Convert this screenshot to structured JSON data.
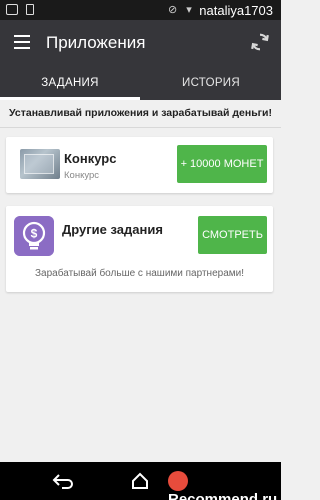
{
  "status_bar": {
    "time": "nataliya1703",
    "sys_icons": "⊘ ▾"
  },
  "app_bar": {
    "title": "Приложения"
  },
  "tabs": [
    {
      "label": "ЗАДАНИЯ",
      "active": true
    },
    {
      "label": "ИСТОРИЯ",
      "active": false
    }
  ],
  "banner": "Устанавливай приложения и зарабатывай деньги!",
  "cards": [
    {
      "title": "Конкурс",
      "subtitle": "Конкурс",
      "button": "+ 10000 МОНЕТ"
    },
    {
      "title": "Другие задания",
      "button": "СМОТРЕТЬ",
      "footer": "Зарабатывай больше с нашими партнерами!"
    }
  ],
  "watermark": "Recommend.ru",
  "colors": {
    "app_bar": "#36363a",
    "accent_green": "#4fb54a",
    "bulb_purple": "#8b6cc4"
  }
}
